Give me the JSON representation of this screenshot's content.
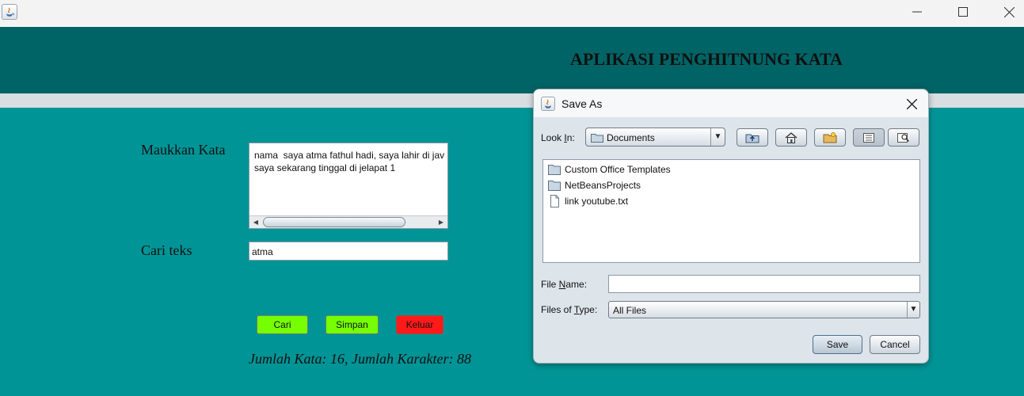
{
  "window": {
    "title": "",
    "controls": [
      "minimize",
      "maximize",
      "close"
    ]
  },
  "header": {
    "title": "APLIKASI PENGHITNUNG KATA"
  },
  "form": {
    "input_label": "Maukkan Kata",
    "textarea_lines": [
      "nama  saya atma fathul hadi, saya lahir di jav",
      "saya sekarang tinggal di jelapat 1"
    ],
    "search_label": "Cari teks",
    "search_value": "atma",
    "buttons": {
      "cari": "Cari",
      "simpan": "Simpan",
      "keluar": "Keluar"
    },
    "result": "Jumlah Kata: 16, Jumlah Karakter: 88",
    "colors": {
      "background": "#009496",
      "header": "#006365",
      "green_button": "#76ff03",
      "red_button": "#ff1a1a"
    }
  },
  "dialog": {
    "title": "Save As",
    "look_in_label_prefix": "Look ",
    "look_in_label_mnemonic": "I",
    "look_in_label_suffix": "n:",
    "look_in_value": "Documents",
    "toolbar_icons": [
      "up-folder-icon",
      "home-icon",
      "new-folder-icon",
      "list-view-icon",
      "details-view-icon"
    ],
    "files": [
      {
        "name": "Custom Office Templates",
        "type": "folder"
      },
      {
        "name": "NetBeansProjects",
        "type": "folder"
      },
      {
        "name": "link youtube.txt",
        "type": "file"
      }
    ],
    "file_name_label_prefix": "File ",
    "file_name_label_mnemonic": "N",
    "file_name_label_suffix": "ame:",
    "file_name_value": "",
    "file_type_label_prefix": "Files of ",
    "file_type_label_mnemonic": "T",
    "file_type_label_suffix": "ype:",
    "file_type_value": "All Files",
    "save_label": "Save",
    "cancel_label": "Cancel"
  }
}
